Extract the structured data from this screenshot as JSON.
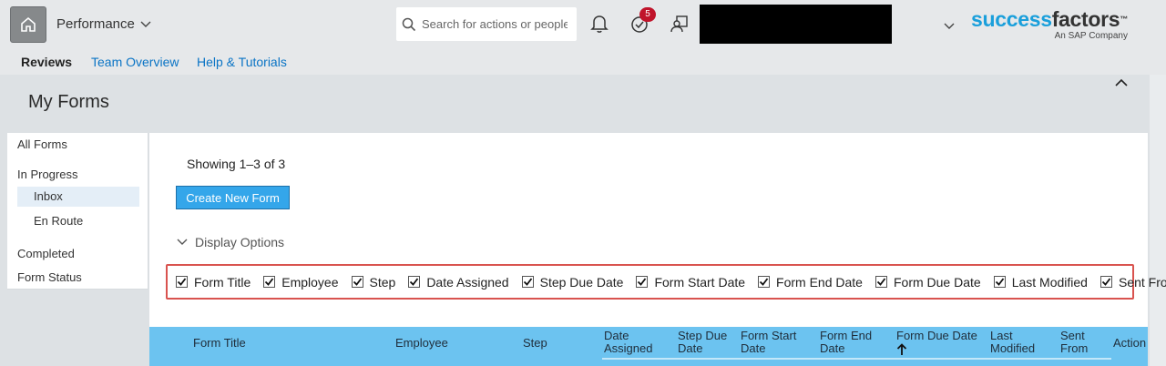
{
  "header": {
    "module": "Performance",
    "search_placeholder": "Search for actions or people",
    "notification_count": "5",
    "logo_part1": "success",
    "logo_part2": "factors",
    "logo_sub": "An SAP Company"
  },
  "subnav": {
    "reviews": "Reviews",
    "team_overview": "Team Overview",
    "help": "Help & Tutorials"
  },
  "page": {
    "title": "My Forms"
  },
  "leftnav": {
    "all_forms": "All Forms",
    "in_progress": "In Progress",
    "inbox": "Inbox",
    "en_route": "En Route",
    "completed": "Completed",
    "form_status": "Form Status"
  },
  "content": {
    "showing": "Showing 1–3 of 3",
    "create_label": "Create New Form",
    "display_options": "Display Options",
    "options": [
      "Form Title",
      "Employee",
      "Step",
      "Date Assigned",
      "Step Due Date",
      "Form Start Date",
      "Form End Date",
      "Form Due Date",
      "Last Modified",
      "Sent From"
    ]
  },
  "table": {
    "columns": {
      "form_title": "Form Title",
      "employee": "Employee",
      "step": "Step",
      "date_assigned_1": "Date",
      "date_assigned_2": "Assigned",
      "step_due_1": "Step Due",
      "step_due_2": "Date",
      "form_start_1": "Form Start",
      "form_start_2": "Date",
      "form_end_1": "Form End",
      "form_end_2": "Date",
      "form_due_1": "Form Due Date",
      "last_mod_1": "Last",
      "last_mod_2": "Modified",
      "sent_from_1": "Sent",
      "sent_from_2": "From",
      "action": "Action"
    }
  },
  "colors": {
    "accent": "#34a6ea",
    "header_row": "#6cc3f0",
    "highlight_border": "#d9534f",
    "link": "#0a74c5",
    "badge": "#c0142b"
  }
}
